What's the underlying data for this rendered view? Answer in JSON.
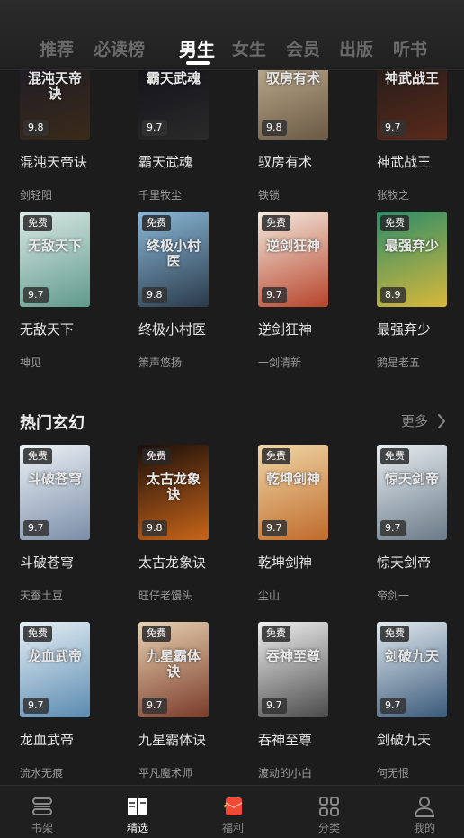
{
  "tabs": [
    {
      "label": "推荐"
    },
    {
      "label": "必读榜"
    },
    {
      "label": "男生"
    },
    {
      "label": "女生"
    },
    {
      "label": "会员"
    },
    {
      "label": "出版"
    },
    {
      "label": "听书"
    }
  ],
  "active_tab": "男生",
  "rows_top": [
    [
      {
        "title": "混沌天帝诀",
        "author": "剑轻阳",
        "rating": "9.8",
        "free": false,
        "cover_text": "混沌天帝诀",
        "colors": [
          "#1a1a2a",
          "#3a2a18"
        ]
      },
      {
        "title": "霸天武魂",
        "author": "千里牧尘",
        "rating": "9.7",
        "free": false,
        "cover_text": "霸天武魂",
        "colors": [
          "#0e0e16",
          "#2a2a2a"
        ]
      },
      {
        "title": "驭房有术",
        "author": "铁锁",
        "rating": "9.8",
        "free": false,
        "cover_text": "驭房有术",
        "colors": [
          "#c9b89a",
          "#6b5a44"
        ]
      },
      {
        "title": "神武战王",
        "author": "张牧之",
        "rating": "9.7",
        "free": false,
        "cover_text": "神武战王",
        "colors": [
          "#1a1a1a",
          "#5a2a1a"
        ]
      }
    ],
    [
      {
        "title": "无敌天下",
        "author": "神见",
        "rating": "9.7",
        "free": true,
        "cover_text": "无敌天下",
        "colors": [
          "#dbe9e6",
          "#5f9a8a"
        ]
      },
      {
        "title": "终极小村医",
        "author": "箫声悠扬",
        "rating": "9.8",
        "free": true,
        "cover_text": "终极小村医",
        "colors": [
          "#8ab8d8",
          "#2a3a4a"
        ]
      },
      {
        "title": "逆剑狂神",
        "author": "一剑清新",
        "rating": "9.7",
        "free": true,
        "cover_text": "逆剑狂神",
        "colors": [
          "#f4ece0",
          "#b7432a"
        ]
      },
      {
        "title": "最强弃少",
        "author": "鹅是老五",
        "rating": "8.9",
        "free": true,
        "cover_text": "最强弃少",
        "colors": [
          "#2c8c6a",
          "#d8b83a"
        ]
      }
    ]
  ],
  "section": {
    "title": "热门玄幻",
    "more_label": "更多"
  },
  "rows_section": [
    [
      {
        "title": "斗破苍穹",
        "author": "天蚕土豆",
        "rating": "9.7",
        "free": true,
        "cover_text": "斗破苍穹",
        "colors": [
          "#eef2f6",
          "#7a8ea8"
        ]
      },
      {
        "title": "太古龙象诀",
        "author": "旺仔老馒头",
        "rating": "9.8",
        "free": true,
        "cover_text": "太古龙象诀",
        "colors": [
          "#1a0e0a",
          "#c8651a"
        ]
      },
      {
        "title": "乾坤剑神",
        "author": "尘山",
        "rating": "9.7",
        "free": true,
        "cover_text": "乾坤剑神",
        "colors": [
          "#f0d8a8",
          "#c06a2a"
        ]
      },
      {
        "title": "惊天剑帝",
        "author": "帝剑一",
        "rating": "9.7",
        "free": true,
        "cover_text": "惊天剑帝",
        "colors": [
          "#e8eef2",
          "#6a7a88"
        ]
      }
    ],
    [
      {
        "title": "龙血武帝",
        "author": "流水无痕",
        "rating": "9.7",
        "free": true,
        "cover_text": "龙血武帝",
        "colors": [
          "#e6f0f6",
          "#5a8ab0"
        ]
      },
      {
        "title": "九星霸体诀",
        "author": "平凡魔术师",
        "rating": "9.7",
        "free": true,
        "cover_text": "九星霸体诀",
        "colors": [
          "#e8d2b0",
          "#7a3a2a"
        ]
      },
      {
        "title": "吞神至尊",
        "author": "渡劫的小白",
        "rating": "9.7",
        "free": true,
        "cover_text": "吞神至尊",
        "colors": [
          "#f0f0f0",
          "#4a4a4a"
        ]
      },
      {
        "title": "剑破九天",
        "author": "何无恨",
        "rating": "9.7",
        "free": true,
        "cover_text": "剑破九天",
        "colors": [
          "#e2eaf0",
          "#3a5a7a"
        ]
      }
    ]
  ],
  "free_label": "免费",
  "bottom_nav": [
    {
      "label": "书架",
      "icon": "bookshelf-icon",
      "active": false
    },
    {
      "label": "精选",
      "icon": "featured-book-icon",
      "active": true
    },
    {
      "label": "福利",
      "icon": "gift-envelope-icon",
      "active": false
    },
    {
      "label": "分类",
      "icon": "category-grid-icon",
      "active": false
    },
    {
      "label": "我的",
      "icon": "profile-icon",
      "active": false
    }
  ],
  "colors": {
    "background": "#1c1c1c",
    "accent": "#f04a36",
    "text": "#e8e8e8",
    "muted": "#9a9a9a"
  }
}
